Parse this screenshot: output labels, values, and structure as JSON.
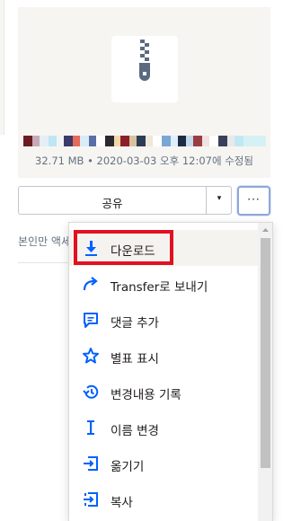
{
  "file": {
    "meta": "32.71 MB • 2020-03-03 오후 12:07에 수정됨",
    "icon": "zip-file-icon"
  },
  "actions": {
    "share_label": "공유",
    "share_caret": "▾",
    "more_label": "···"
  },
  "access_text": "본인만 액세스",
  "menu": {
    "items": [
      {
        "label": "다운로드",
        "icon": "download-icon"
      },
      {
        "label": "Transfer로 보내기",
        "icon": "transfer-arrow-icon"
      },
      {
        "label": "댓글 추가",
        "icon": "comment-icon"
      },
      {
        "label": "별표 표시",
        "icon": "star-icon"
      },
      {
        "label": "변경내용 기록",
        "icon": "history-icon"
      },
      {
        "label": "이름 변경",
        "icon": "rename-cursor-icon"
      },
      {
        "label": "옮기기",
        "icon": "move-icon"
      },
      {
        "label": "복사",
        "icon": "copy-icon"
      }
    ]
  },
  "colors": {
    "icon_blue": "#0061fe",
    "highlight_red": "#e3101f",
    "meta_gray": "#637282",
    "preview_bg": "#f7f5f2"
  }
}
